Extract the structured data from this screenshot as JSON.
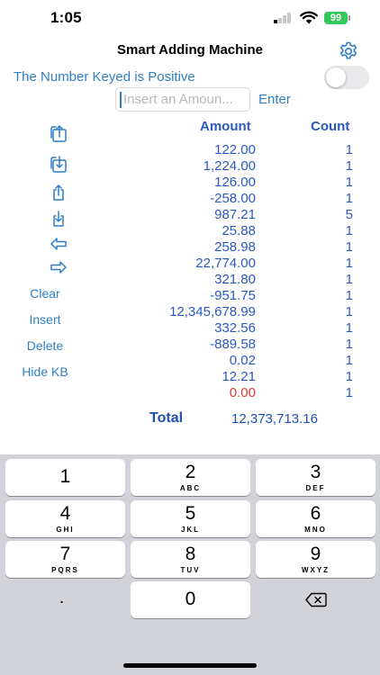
{
  "status_bar": {
    "time": "1:05",
    "battery": "99"
  },
  "header": {
    "title": "Smart Adding Machine"
  },
  "positive_toggle": {
    "label": "The Number Keyed is Positive",
    "on": false
  },
  "amount_input": {
    "placeholder": "Insert an Amoun...",
    "value": ""
  },
  "enter_label": "Enter",
  "side_buttons": {
    "clear": "Clear",
    "insert": "Insert",
    "delete": "Delete",
    "hide_kb": "Hide KB"
  },
  "table": {
    "amount_header": "Amount",
    "count_header": "Count",
    "rows": [
      {
        "amount": "122.00",
        "count": "1"
      },
      {
        "amount": "1,224.00",
        "count": "1"
      },
      {
        "amount": "126.00",
        "count": "1"
      },
      {
        "amount": "-258.00",
        "count": "1"
      },
      {
        "amount": "987.21",
        "count": "5"
      },
      {
        "amount": "25.88",
        "count": "1"
      },
      {
        "amount": "258.98",
        "count": "1"
      },
      {
        "amount": "22,774.00",
        "count": "1"
      },
      {
        "amount": "321.80",
        "count": "1"
      },
      {
        "amount": "-951.75",
        "count": "1"
      },
      {
        "amount": "12,345,678.99",
        "count": "1"
      },
      {
        "amount": "332.56",
        "count": "1"
      },
      {
        "amount": "-889.58",
        "count": "1"
      },
      {
        "amount": "0.02",
        "count": "1"
      },
      {
        "amount": "12.21",
        "count": "1"
      },
      {
        "amount": "0.00",
        "count": "1"
      }
    ]
  },
  "total": {
    "label": "Total",
    "value": "12,373,713.16"
  },
  "keyboard": {
    "keys": [
      {
        "digit": "1",
        "letters": ""
      },
      {
        "digit": "2",
        "letters": "ABC"
      },
      {
        "digit": "3",
        "letters": "DEF"
      },
      {
        "digit": "4",
        "letters": "GHI"
      },
      {
        "digit": "5",
        "letters": "JKL"
      },
      {
        "digit": "6",
        "letters": "MNO"
      },
      {
        "digit": "7",
        "letters": "PQRS"
      },
      {
        "digit": "8",
        "letters": "TUV"
      },
      {
        "digit": "9",
        "letters": "WXYZ"
      }
    ],
    "decimal": ".",
    "zero": "0"
  },
  "colors": {
    "accent": "#2f7fc4",
    "table_text": "#2a59c2",
    "highlight_red": "#e03a3a",
    "battery_green": "#34c759"
  }
}
